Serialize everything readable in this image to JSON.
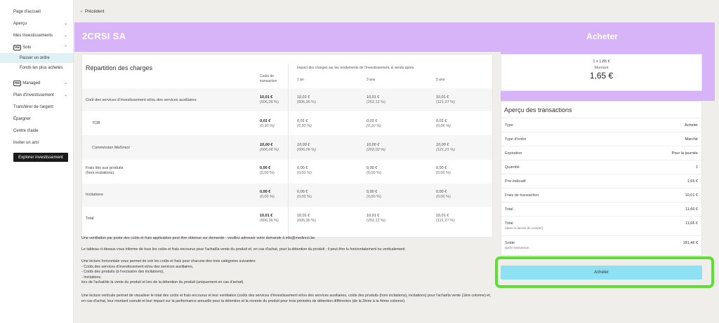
{
  "sidebar": {
    "items": [
      {
        "label": "Page d'accueil",
        "chevron": false
      },
      {
        "label": "Aperçu",
        "chevron": true
      },
      {
        "label": "Mes Investissements",
        "chevron": true
      }
    ],
    "solo": {
      "badge": "me",
      "label": "Solo",
      "sub": [
        "Passer un ordre",
        "Fonds les plus achetés"
      ]
    },
    "managed": {
      "badge": "me",
      "label": "Managed"
    },
    "items2": [
      {
        "label": "Plan d'investissement",
        "chevron": true
      },
      {
        "label": "Transférer de l'argent"
      },
      {
        "label": "Épargner"
      },
      {
        "label": "Centre d'aide"
      },
      {
        "label": "Inviter un ami"
      }
    ],
    "explore_button": "Explorer investissement"
  },
  "nav": {
    "back": "Précédent"
  },
  "header": {
    "company": "2CRSI SA",
    "buy_title": "Acheter"
  },
  "charges": {
    "title": "Répartition des charges",
    "col_cost": "Coûts de transaction",
    "col_impact": "Impact des charges sur les rendements de l'investissement, si vendu après",
    "periods": [
      "1 an",
      "3 ans",
      "5 ans"
    ],
    "rows": [
      {
        "label": "Coût des services d'investissement et/ou des services auxiliaires",
        "cost": "10,01 €",
        "cost_pct": "(606,36 %)",
        "y1": "10,01 €",
        "y1p": "(606,36 %)",
        "y3": "10,01 €",
        "y3p": "(202,12 %)",
        "y5": "10,01 €",
        "y5p": "(121,27 %)"
      },
      {
        "label": "TOB",
        "cost": "0,01 €",
        "cost_pct": "(0,30 %)",
        "y1": "0,01 €",
        "y1p": "(0,30 %)",
        "y3": "0,01 €",
        "y3p": "(0,10 %)",
        "y5": "0,01 €",
        "y5p": "(0,06 %)"
      },
      {
        "label": "Commission MeDirect",
        "cost": "10,00 €",
        "cost_pct": "(606,06 %)",
        "y1": "10,00 €",
        "y1p": "(606,06 %)",
        "y3": "10,00 €",
        "y3p": "(202,02 %)",
        "y5": "10,00 €",
        "y5p": "(121,21 %)"
      },
      {
        "label": "Frais liés aux produits",
        "label2": "(hors incitations)",
        "cost": "0,00 €",
        "cost_pct": "(0,00 %)",
        "y1": "0,00 €",
        "y1p": "(0,00 %)",
        "y3": "0,00 €",
        "y3p": "(0,00 %)",
        "y5": "0,00 €",
        "y5p": "(0,00 %)"
      },
      {
        "label": "Incitations",
        "cost": "0,00 €",
        "cost_pct": "(0,00 %)",
        "y1": "0,00 €",
        "y1p": "(0,00 %)",
        "y3": "0,00 €",
        "y3p": "(0,00 %)",
        "y5": "0,00 €",
        "y5p": "(0,00 %)"
      },
      {
        "label": "Total",
        "cost": "10,01 €",
        "cost_pct": "(606,36 %)",
        "y1": "10,01 €",
        "y1p": "(606,36 %)",
        "y3": "10,01 €",
        "y3p": "(202,12 %)",
        "y5": "10,01 €",
        "y5p": "(121,27 %)"
      }
    ]
  },
  "notes": {
    "p1": "Une ventilation par poste des coûts et frais applicables peut être obtenue sur demande - veuillez adresser votre demande à info@medirect.be.",
    "p2": "Le tableau ci-dessus vous informe de tous les coûts et frais encourus pour l'achat/la vente du produit et, en cas d'achat, pour la détention du produit ; il peut être lu horizontalement ou verticalement.",
    "p3a": "Une lecture horizontale vous permet de voir les coûts et frais pour chacune des trois catégories suivantes:",
    "p3b": "- Coûts des services d'investissement et/ou des services auxiliaires,",
    "p3c": "- Coûts des produits (à l'exclusion des incitations),",
    "p3d": "- Incitations,",
    "p3e": "lors de l'achat/de la vente du produit et lors de la détention du produit (uniquement en cas d'achat).",
    "p4": "Une lecture verticale permet de visualiser le total des coûts et frais encourus et leur ventilation (coûts des services d'investissement et/ou des services auxiliaires, coûts des produits (hors incitations), incitations) pour l'achat/la vente (1ère colonne) et, en cas d'achat, leur montant cumulé et leur impact sur la performance annuelle pour la détention et la revente du produit pour trois périodes de détention différentes (de la 2ème à la 4ème colonne)."
  },
  "order": {
    "qty_price": "1 x 1,65 €",
    "montant_label": "Montant",
    "montant": "1,65 €"
  },
  "transactions": {
    "title": "Aperçu des transactions",
    "rows": [
      {
        "label": "Type",
        "value": "Acheter"
      },
      {
        "label": "Type d'ordre",
        "value": "Marché"
      },
      {
        "label": "Expiration",
        "value": "Pour la journée"
      },
      {
        "label": "Quantité",
        "value": "1"
      },
      {
        "label": "Prix indicatif",
        "value": "1,65 €"
      },
      {
        "label": "Frais de transaction",
        "value": "10,01 €"
      },
      {
        "label": "Total",
        "value": "11,66 €"
      },
      {
        "label": "Total",
        "note": "(dans la devise du compte)",
        "value": "11,66 €"
      },
      {
        "label": "Solde",
        "note": "après transaction",
        "value": "181,46 €"
      }
    ],
    "buy_button": "Acheter"
  },
  "colors": {
    "accent": "#d7b4f7",
    "button": "#8ee1f2",
    "highlight": "#5fdf34"
  }
}
